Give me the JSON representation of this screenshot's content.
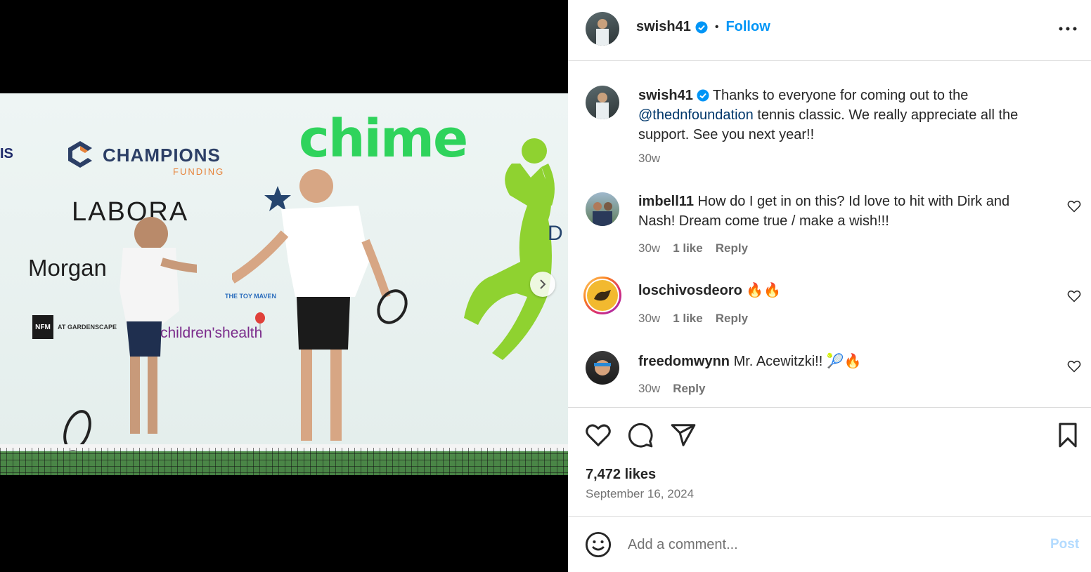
{
  "post": {
    "username": "swish41",
    "follow_label": "Follow",
    "separator": "•",
    "caption": {
      "username": "swish41",
      "text_before": "Thanks to everyone for coming out to the ",
      "mention": "@thednfoundation",
      "text_after": " tennis classic. We really appreciate all the support. See you next year!!",
      "time": "30w"
    },
    "likes": "7,472 likes",
    "date": "September 16, 2024"
  },
  "media": {
    "sponsors": {
      "chime": "chime",
      "champions": "CHAMPIONS",
      "funding": "FUNDING",
      "labora": "LABORA",
      "morgan": "Morgan",
      "toy_maven": "THE TOY MAVEN",
      "childrens": "children'shealth",
      "nfm": "NFM",
      "at": "AT",
      "scape": "GARDENSCAPE"
    },
    "carousel": {
      "total": 3,
      "active": 0
    }
  },
  "comments": [
    {
      "username": "imbell11",
      "text": "How do I get in on this? Id love to hit with Dirk and Nash! Dream come true / make a wish!!!",
      "time": "30w",
      "likes": "1 like",
      "reply": "Reply"
    },
    {
      "username": "loschivosdeoro",
      "text": "🔥🔥",
      "time": "30w",
      "likes": "1 like",
      "reply": "Reply"
    },
    {
      "username": "freedomwynn",
      "text": "Mr. Acewitzki!! 🎾🔥",
      "time": "30w",
      "likes": "",
      "reply": "Reply"
    }
  ],
  "composer": {
    "placeholder": "Add a comment...",
    "post_label": "Post"
  },
  "icons": {
    "like": "heart-icon",
    "comment": "comment-icon",
    "share": "share-icon",
    "save": "bookmark-icon",
    "more": "more-icon",
    "emoji": "emoji-icon",
    "next": "chevron-right-icon"
  },
  "colors": {
    "accent": "#0095f6",
    "mention": "#00376b",
    "muted": "#737373",
    "chime_green": "#2fd35c",
    "silhouette": "#8fd230"
  }
}
